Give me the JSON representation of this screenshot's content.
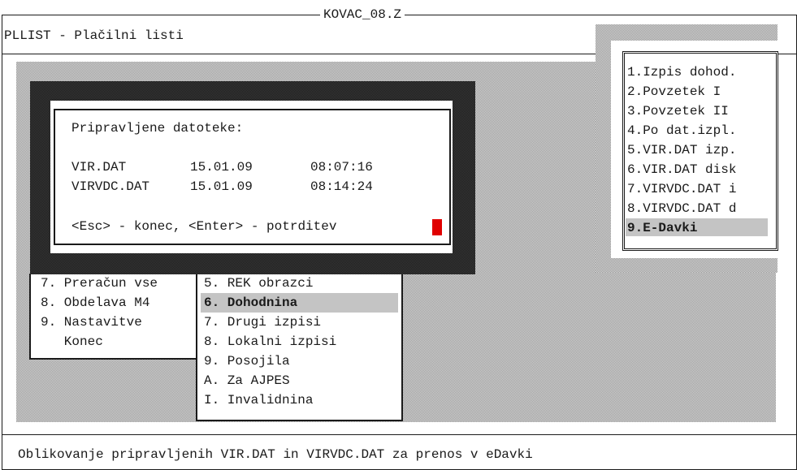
{
  "window": {
    "title": "KOVAC_08.Z"
  },
  "header": {
    "title": "PLLIST - Plačilni listi"
  },
  "main_menu": {
    "items": [
      {
        "label": "7. Preračun vse"
      },
      {
        "label": "8. Obdelava M4"
      },
      {
        "label": "9. Nastavitve"
      },
      {
        "label": "   Konec"
      }
    ]
  },
  "submenu": {
    "items": [
      {
        "label": "5. REK obrazci"
      },
      {
        "label": "6. Dohodnina",
        "selected": true
      },
      {
        "label": "7. Drugi izpisi"
      },
      {
        "label": "8. Lokalni izpisi"
      },
      {
        "label": "9. Posojila"
      },
      {
        "label": "A. Za AJPES"
      },
      {
        "label": "I. Invalidnina"
      }
    ]
  },
  "side_menu": {
    "items": [
      {
        "label": "1.Izpis dohod."
      },
      {
        "label": "2.Povzetek I"
      },
      {
        "label": "3.Povzetek II"
      },
      {
        "label": "4.Po dat.izpl."
      },
      {
        "label": "5.VIR.DAT izp."
      },
      {
        "label": "6.VIR.DAT disk"
      },
      {
        "label": "7.VIRVDC.DAT i"
      },
      {
        "label": "8.VIRVDC.DAT d"
      },
      {
        "label": "9.E-Davki",
        "selected": true
      }
    ]
  },
  "dialog": {
    "heading": "Pripravljene datoteke:",
    "files": [
      {
        "name": "VIR.DAT",
        "date": "15.01.09",
        "time": "08:07:16"
      },
      {
        "name": "VIRVDC.DAT",
        "date": "15.01.09",
        "time": "08:14:24"
      }
    ],
    "hint": "<Esc> - konec, <Enter> - potrditev",
    "cursor_color": "#e00000"
  },
  "status_bar": {
    "text": "Oblikovanje pripravljenih VIR.DAT in VIRVDC.DAT za prenos v eDavki"
  },
  "colors": {
    "highlight": "#c4c4c4",
    "frame": "#1a1a1a",
    "background": "#ffffff"
  }
}
